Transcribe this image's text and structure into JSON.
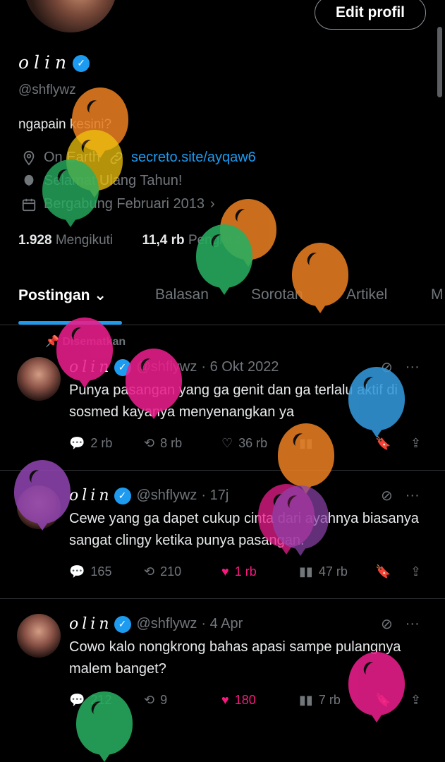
{
  "profile": {
    "edit_button": "Edit profil",
    "name": "olin",
    "handle": "@shflywz",
    "bio": "ngapain kesini?",
    "location": "On Earth",
    "website": "secreto.site/ayqaw6",
    "birthday": "Selamat Ulang Tahun!",
    "joined": "Bergabung Februari 2013",
    "following_count": "1.928",
    "following_label": "Mengikuti",
    "followers_count": "11,4 rb",
    "followers_label": "Pengikut"
  },
  "tabs": [
    "Postingan",
    "Balasan",
    "Sorotan",
    "Artikel",
    "M"
  ],
  "pinned_label": "Disematkan",
  "posts": [
    {
      "name": "olin",
      "handle": "@shflywz",
      "time": "· 6 Okt 2022",
      "text": "Punya pasangan yang ga genit dan ga terlalu aktif di sosmed kayanya menyenangkan ya",
      "replies": "2 rb",
      "reposts": "8 rb",
      "likes": "36 rb",
      "views": "",
      "liked": false
    },
    {
      "name": "olin",
      "handle": "@shflywz",
      "time": "· 17j",
      "text": "Cewe yang ga dapet cukup cinta dari ayahnya biasanya sangat clingy ketika punya pasangan.",
      "replies": "165",
      "reposts": "210",
      "likes": "1 rb",
      "views": "47 rb",
      "liked": true
    },
    {
      "name": "olin",
      "handle": "@shflywz",
      "time": "· 4 Apr",
      "text": "Cowo kalo nongkrong bahas apasi sampe pulangnya malem banget?",
      "replies": "212",
      "reposts": "9",
      "likes": "180",
      "views": "7 rb",
      "liked": true
    }
  ],
  "colors": {
    "accent": "#1d9bf0",
    "like": "#f91880",
    "muted": "#71767b",
    "balloons": [
      "#e67e22",
      "#f1c40f",
      "#27ae60",
      "#e91e8c",
      "#3498db",
      "#8e44ad"
    ]
  }
}
